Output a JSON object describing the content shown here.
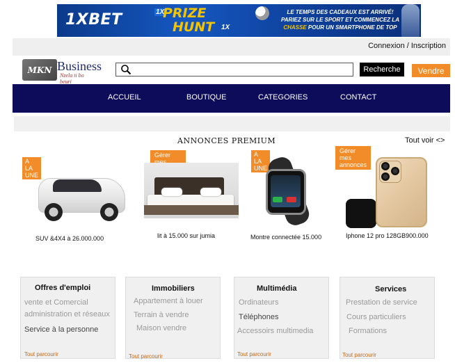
{
  "ad": {
    "logo": "1XBET",
    "prize_line1": "PRIZE",
    "prize_line2": "HUNT",
    "tag1": "1X",
    "tag2": "1X",
    "text_line1": "LE TEMPS DES CADEAUX EST ARRIVÉ!",
    "text_line2": "PARIEZ SUR LE SPORT ET COMMENCEZ LA",
    "text_line3_hl": "CHASSE",
    "text_line3": " POUR UN SMARTPHONE DE TOP"
  },
  "topbar": {
    "login": "Connexion / Inscription"
  },
  "logo": {
    "badge": "MKN",
    "name": "Business",
    "slogan": "Nzela ti bo beuri"
  },
  "search": {
    "placeholder": "",
    "button": "Recherche"
  },
  "sell_button": "Vendre",
  "nav": [
    "ACCUEIL",
    "BOUTIQUE",
    "CATEGORIES",
    "CONTACT"
  ],
  "premium": {
    "title": "ANNONCES PREMIUM",
    "see_all": "Tout voir <>",
    "cards": [
      {
        "tag": "A LA UNE",
        "caption": "SUV &4X4 à 26.000.000"
      },
      {
        "tag": "Gérer mes annonces",
        "caption": "lit à 15.000 sur jumia"
      },
      {
        "tag": "A LA UNE",
        "caption": "Montre connectée  15.000"
      },
      {
        "tag": "Gérer mes annonces",
        "caption": "Iphone 12 pro 128GB900.000"
      }
    ]
  },
  "categories": [
    {
      "title": "Offres d'emploi",
      "items": [
        "vente et Comercial",
        "administration et réseaux",
        "Service à la personne"
      ],
      "more": "Tout parcourir"
    },
    {
      "title": "Immobiliers",
      "items": [
        "Appartement à louer",
        "Terrain à vendre",
        "Maison vendre"
      ],
      "more": "Tout parcourir"
    },
    {
      "title": "Multimédia",
      "items": [
        "Ordinateurs",
        "Téléphones",
        "Accessoirs multimedia"
      ],
      "more": "Tout parcourir"
    },
    {
      "title": "Services",
      "items": [
        "Prestation de service",
        "Cours particuliers",
        "Formations"
      ],
      "more": "Tout parcourir"
    }
  ],
  "colors": {
    "nav_bg": "#0c0c5a",
    "accent_orange": "#f28c28",
    "ad_blue": "#1557c0",
    "ad_yellow": "#f5c400"
  }
}
